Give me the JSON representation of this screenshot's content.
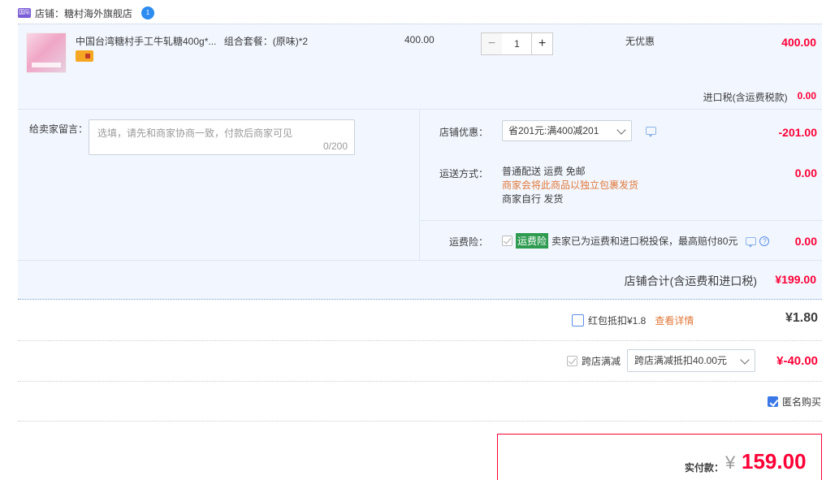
{
  "store": {
    "badge": "国际",
    "label": "店铺：糖村海外旗舰店",
    "chat_badge": "1"
  },
  "item": {
    "title": "中国台湾糖村手工牛轧糖400g*...",
    "spec": "组合套餐：(原味)*2",
    "unit_price": "400.00",
    "qty_minus": "−",
    "quantity": "1",
    "qty_plus": "+",
    "discount": "无优惠",
    "total": "400.00",
    "tax_label": "进口税(含运费税款)",
    "tax_value": "0.00"
  },
  "message": {
    "label": "给卖家留言：",
    "placeholder": "选填，请先和商家协商一致，付款后商家可见",
    "count": "0/200"
  },
  "store_promo": {
    "label": "店铺优惠：",
    "selected": "省201元:满400减201",
    "amount": "-201.00"
  },
  "shipping": {
    "label": "运送方式：",
    "line1": "普通配送 运费 免邮",
    "line2": "商家会将此商品以独立包裹发货",
    "line3": "商家自行  发货",
    "amount": "0.00"
  },
  "insurance": {
    "label": "运费险：",
    "tag": "运费险",
    "text": "卖家已为运费和进口税投保，最高赔付80元",
    "help": "?",
    "amount": "0.00"
  },
  "store_total": {
    "label": "店铺合计(含运费和进口税)",
    "value": "¥199.00"
  },
  "red_packet": {
    "label": "红包抵扣¥1.8",
    "link": "查看详情",
    "amount": "¥1.80"
  },
  "cross_store": {
    "label": "跨店满减",
    "selected": "跨店满减抵扣40.00元",
    "amount": "¥-40.00"
  },
  "anonymous": {
    "label": "匿名购买"
  },
  "payment": {
    "label": "实付款：",
    "currency": "¥",
    "value": "159.00"
  },
  "colors": {
    "accent_red": "#ff0036",
    "panel_bg": "#f2f7ff",
    "link_orange": "#e0783a",
    "check_blue": "#3a78e8"
  }
}
